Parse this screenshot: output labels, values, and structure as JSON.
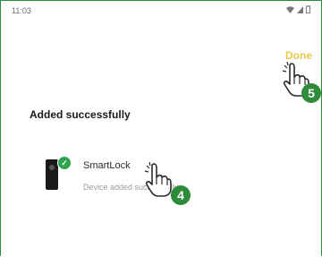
{
  "status_bar": {
    "time": "11:03",
    "icons": [
      "wifi-icon",
      "signal-icon",
      "battery-icon"
    ]
  },
  "header": {
    "done_label": "Done"
  },
  "main": {
    "title": "Added successfully",
    "device": {
      "name": "SmartLock",
      "status": "Device added successfully",
      "icon": "smartlock-device-icon"
    }
  },
  "annotations": {
    "step_done": "5",
    "step_device": "4"
  },
  "colors": {
    "accent": "#e8c64a",
    "success": "#2ea44f",
    "badge": "#2e8b3a",
    "frame_border": "#2e8b3a"
  }
}
